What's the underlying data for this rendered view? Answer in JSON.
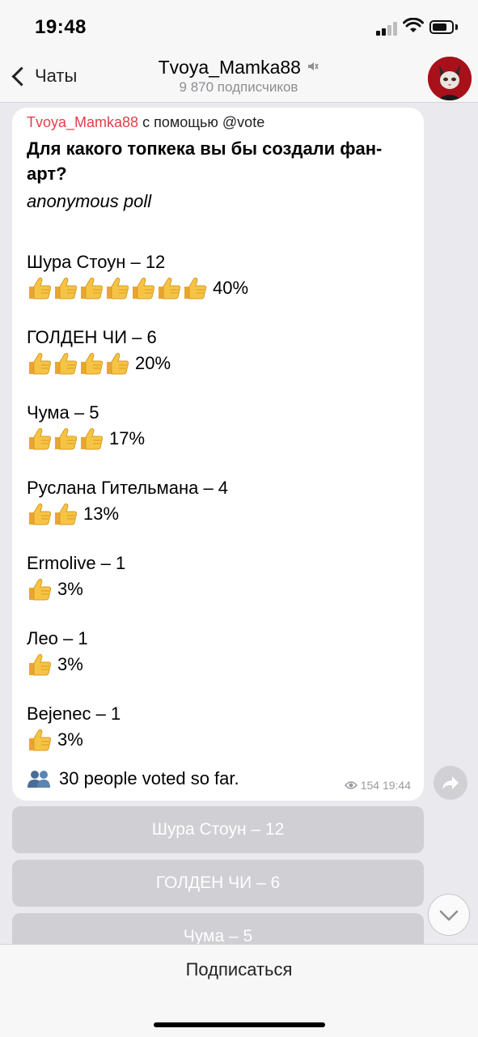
{
  "status_bar": {
    "time": "19:48"
  },
  "nav": {
    "back_label": "Чаты",
    "title": "Tvoya_Mamka88",
    "subtitle": "9 870 подписчиков"
  },
  "message": {
    "via_bot": "Tvoya_Mamka88",
    "via_text": "с помощью @vote",
    "question": "Для какого топкека вы бы создали фан-арт?",
    "poll_type": "anonymous poll",
    "options": [
      {
        "label": "Шура Стоун – 12",
        "thumbs": 7,
        "percent": "40%"
      },
      {
        "label": "ГОЛДЕН ЧИ – 6",
        "thumbs": 4,
        "percent": "20%"
      },
      {
        "label": "Чума – 5",
        "thumbs": 3,
        "percent": "17%"
      },
      {
        "label": "Руслана Гительмана – 4",
        "thumbs": 2,
        "percent": "13%"
      },
      {
        "label": "Ermolive – 1",
        "thumbs": 1,
        "percent": "3%"
      },
      {
        "label": "Лео – 1",
        "thumbs": 1,
        "percent": "3%"
      },
      {
        "label": "Bejenec – 1",
        "thumbs": 1,
        "percent": "3%"
      }
    ],
    "voted": "30 people voted so far.",
    "views": "154",
    "time": "19:44"
  },
  "keyboard_buttons": [
    "Шура Стоун – 12",
    "ГОЛДЕН ЧИ – 6",
    "Чума – 5"
  ],
  "bottom": {
    "subscribe_label": "Подписаться"
  },
  "colors": {
    "accent_red": "#e0404a",
    "thumb_yellow": "#f6c445",
    "button_gray": "#cfcfd4"
  }
}
